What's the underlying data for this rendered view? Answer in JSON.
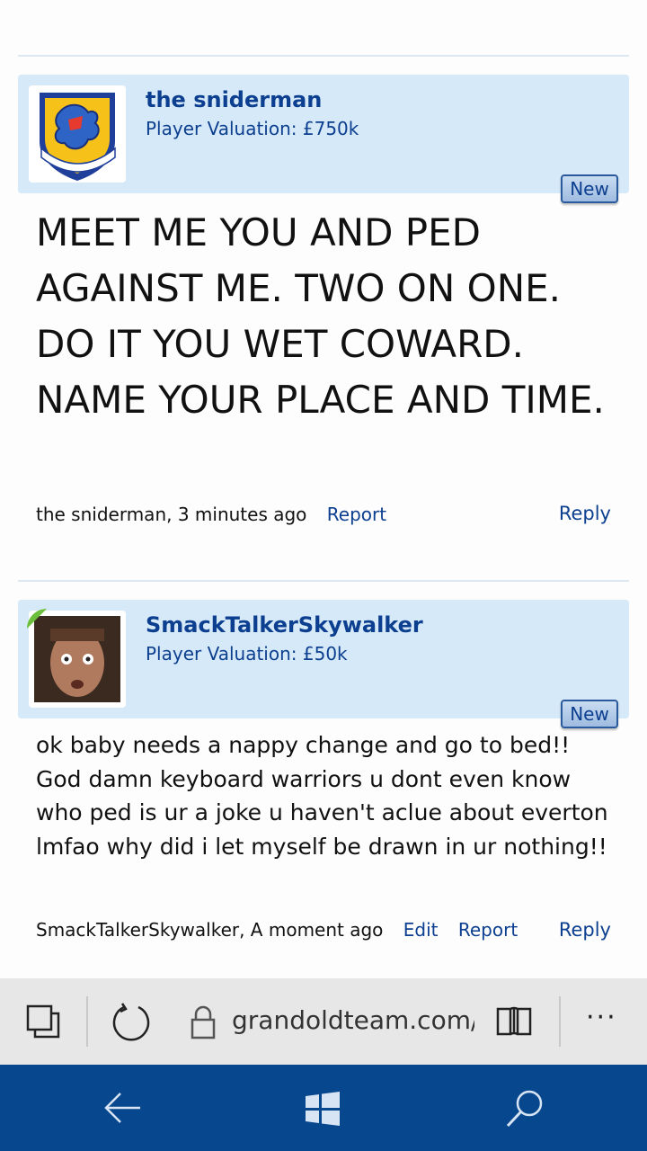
{
  "posts": [
    {
      "username": "the sniderman",
      "valuation": "Player Valuation: £750k",
      "badge": "New",
      "body": "MEET ME YOU AND PED AGAINST ME. TWO ON ONE. DO IT YOU WET COWARD. NAME YOUR PLACE AND TIME.",
      "meta": "the sniderman, 3 minutes ago",
      "report": "Report",
      "reply": "Reply",
      "avatar": "81st-training-wing-emblem"
    },
    {
      "username": "SmackTalkerSkywalker",
      "valuation": "Player Valuation: £50k",
      "badge": "New",
      "body": "ok baby needs a nappy change and go to bed!! God damn keyboard warriors u dont even know who ped is ur a joke u haven't aclue about everton lmfao why did i let myself be drawn in ur nothing!!",
      "meta": "SmackTalkerSkywalker, A moment ago",
      "edit": "Edit",
      "report": "Report",
      "reply": "Reply",
      "avatar": "user-photo"
    }
  ],
  "browser": {
    "url": "grandoldteam.com/t",
    "icons": [
      "tabs-icon",
      "refresh-icon",
      "lock-icon",
      "reading-view-icon",
      "more-icon"
    ],
    "more_label": "···"
  },
  "taskbar": {
    "icons": [
      "back-arrow-icon",
      "windows-logo-icon",
      "search-icon"
    ]
  },
  "colors": {
    "header_bg": "#d6e9f9",
    "link": "#0c3f8f",
    "taskbar": "#07478d",
    "addressbar": "#e7e7e7"
  }
}
